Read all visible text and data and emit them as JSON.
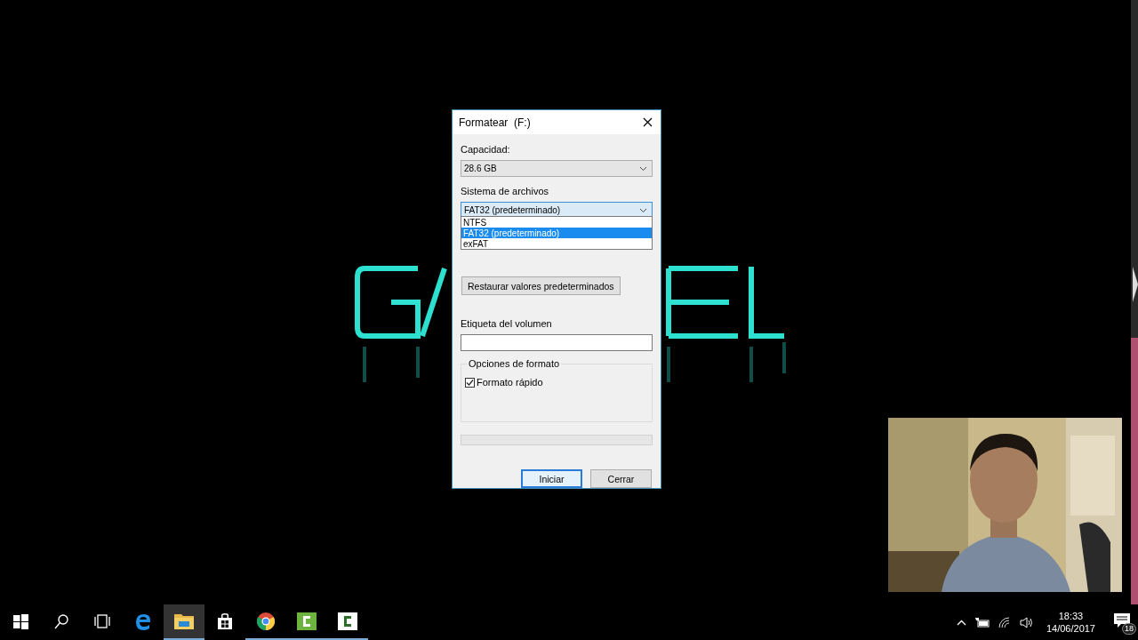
{
  "window": {
    "title": "Formatear  (F:)"
  },
  "capacity": {
    "label": "Capacidad:",
    "value": "28.6 GB"
  },
  "file_system": {
    "label": "Sistema de archivos",
    "value": "FAT32 (predeterminado)",
    "expanded": true,
    "options": [
      {
        "label": "NTFS",
        "selected": false
      },
      {
        "label": "FAT32 (predeterminado)",
        "selected": true
      },
      {
        "label": "exFAT",
        "selected": false
      }
    ]
  },
  "restore_button": "Restaurar valores predeterminados",
  "volume_label": {
    "label": "Etiqueta del volumen"
  },
  "format_options": {
    "title": "Opciones de formato",
    "quick_format": {
      "label": "Formato rápido",
      "checked": true
    }
  },
  "progress": {
    "level": 0
  },
  "buttons": [
    {
      "label": "Iniciar",
      "default": true
    },
    {
      "label": "Cerrar",
      "default": false
    }
  ],
  "taskbar": {
    "apps": [
      {
        "kind": "start",
        "active": false,
        "running": false
      },
      {
        "kind": "search",
        "active": false,
        "running": false
      },
      {
        "kind": "taskview",
        "active": false,
        "running": false
      },
      {
        "kind": "edge",
        "active": false,
        "running": false
      },
      {
        "kind": "explorer",
        "active": true,
        "running": true
      },
      {
        "kind": "store",
        "active": false,
        "running": false
      },
      {
        "kind": "chrome",
        "active": false,
        "running": true
      },
      {
        "kind": "camtasia",
        "active": false,
        "running": true
      },
      {
        "kind": "camrec",
        "active": false,
        "running": true
      }
    ],
    "time": "18:33",
    "date": "14/06/2017",
    "notifications": "18"
  }
}
